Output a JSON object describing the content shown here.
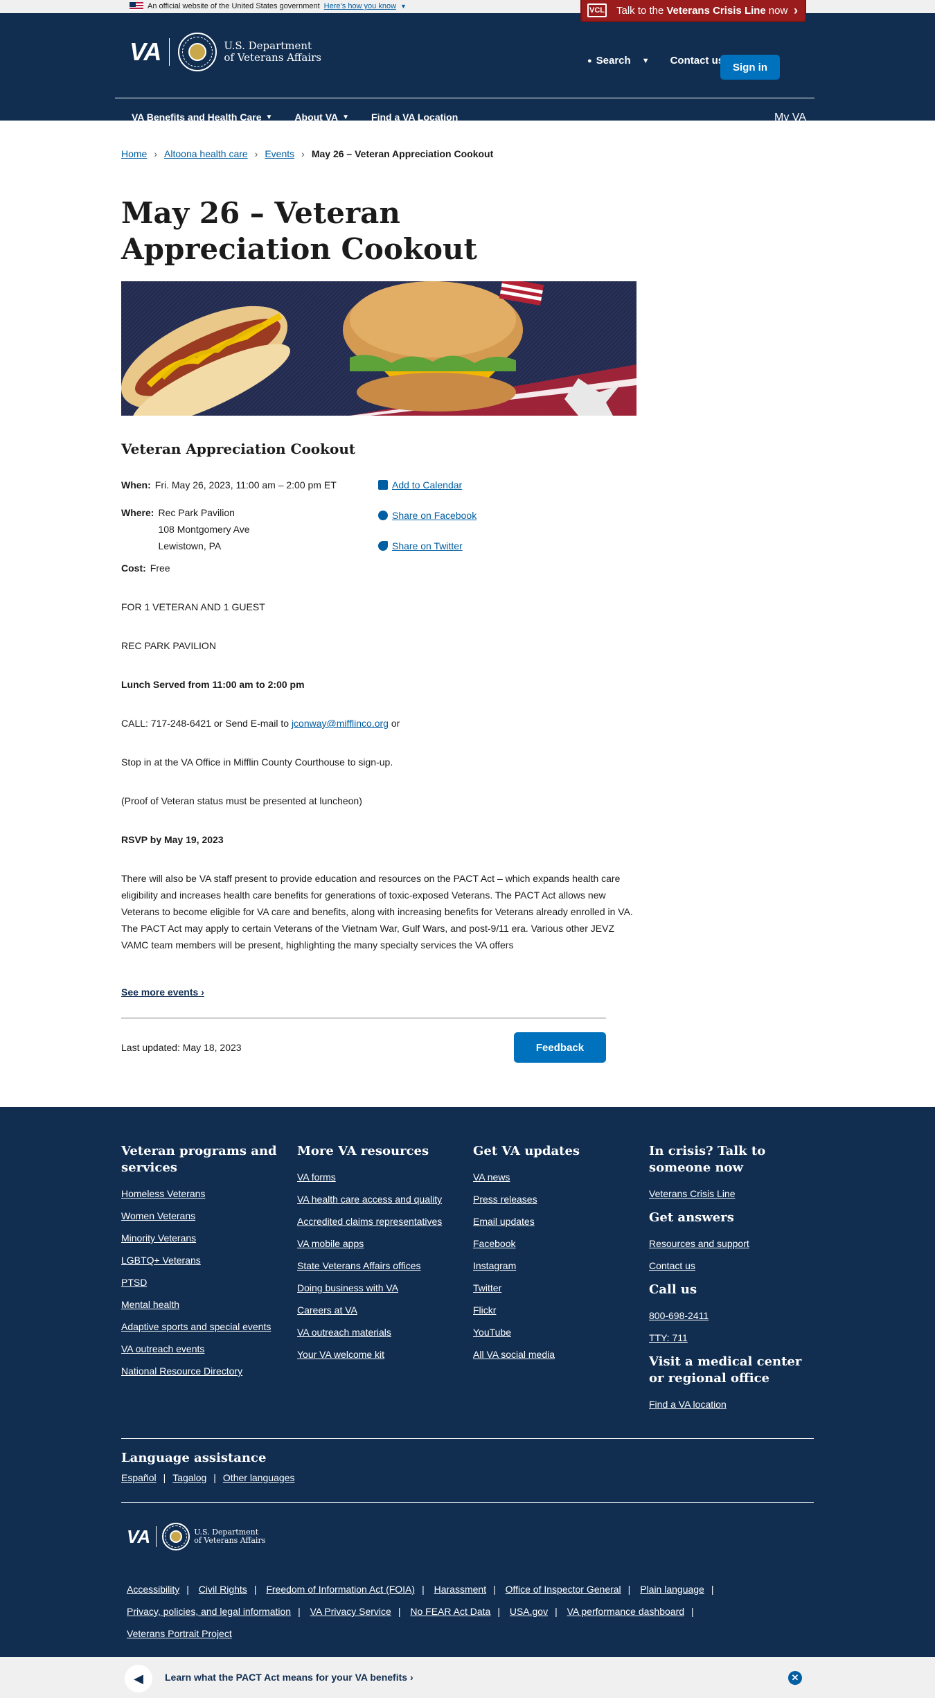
{
  "official_banner": {
    "text": "An official website of the United States government",
    "link": "Here’s how you know"
  },
  "crisis": {
    "prefix": "Talk to the",
    "name": "Veterans Crisis Line",
    "suffix": "now",
    "icon_text": "VCL"
  },
  "header": {
    "logo_va": "VA",
    "dept_line1": "U.S. Department",
    "dept_line2": "of Veterans Affairs",
    "search_label": "Search",
    "contact_label": "Contact us",
    "signin_label": "Sign in"
  },
  "nav": {
    "items": [
      "VA Benefits and Health Care",
      "About VA",
      "Find a VA Location"
    ],
    "myva": "My VA"
  },
  "breadcrumb": [
    "Home",
    "Altoona health care",
    "Events",
    "May 26 – Veteran Appreciation Cookout"
  ],
  "page": {
    "title": "May 26 – Veteran Appreciation Cookout",
    "event_heading": "Veteran Appreciation Cookout",
    "when_label": "When:",
    "when_value": "Fri. May 26, 2023, 11:00 am – 2:00 pm ET",
    "where_label": "Where:",
    "where_line1": "Rec Park Pavilion",
    "where_line2": "108 Montgomery Ave",
    "where_line3": "Lewistown, PA",
    "cost_label": "Cost:",
    "cost_value": "Free",
    "actions": [
      "Add to Calendar",
      "Share on Facebook",
      "Share on Twitter"
    ],
    "para1": "FOR 1 VETERAN AND 1 GUEST",
    "para2": "REC PARK PAVILION",
    "para3": "Lunch Served from 11:00 am to 2:00 pm",
    "para4_prefix": " CALL: 717-248-6421 or Send E-mail to ",
    "para4_email": "jconway@mifflinco.org",
    "para4_suffix": " or",
    "para5": "Stop in at the VA Office in Mifflin County Courthouse to sign-up.",
    "para6": "(Proof of Veteran status must be presented at luncheon)",
    "para7": "RSVP by May 19, 2023",
    "para8": "There will also be VA staff present to provide education and resources on the PACT Act – which expands health care eligibility and increases health care benefits for generations of toxic-exposed Veterans. The PACT Act allows new Veterans to become eligible for VA care and benefits, along with increasing benefits for Veterans already enrolled in VA. The PACT Act may apply to certain Veterans of the Vietnam War, Gulf Wars, and post-9/11 era. Various other JEVZ VAMC team members will be present, highlighting the many specialty services the VA offers",
    "see_more": "See more events",
    "last_updated": "Last updated: May 18, 2023",
    "feedback": "Feedback"
  },
  "footer": {
    "col1": {
      "title": "Veteran programs and services",
      "links": [
        "Homeless Veterans",
        "Women Veterans",
        "Minority Veterans",
        "LGBTQ+ Veterans",
        "PTSD",
        "Mental health",
        "Adaptive sports and special events",
        "VA outreach events",
        "National Resource Directory"
      ]
    },
    "col2": {
      "title": "More VA resources",
      "links": [
        "VA forms",
        "VA health care access and quality",
        "Accredited claims representatives",
        "VA mobile apps",
        "State Veterans Affairs offices",
        "Doing business with VA",
        "Careers at VA",
        "VA outreach materials",
        "Your VA welcome kit"
      ]
    },
    "col3": {
      "title": "Get VA updates",
      "links": [
        "VA news",
        "Press releases",
        "Email updates",
        "Facebook",
        "Instagram",
        "Twitter",
        "Flickr",
        "YouTube",
        "All VA social media"
      ]
    },
    "col4": {
      "title": "In crisis? Talk to someone now",
      "crisis_link": "Veterans Crisis Line",
      "answers_title": "Get answers",
      "answers_links": [
        "Resources and support",
        "Contact us"
      ],
      "call_title": "Call us",
      "call_links": [
        "800-698-2411",
        "TTY: 711"
      ],
      "visit_title": "Visit a medical center or regional office",
      "visit_link": "Find a VA location"
    },
    "language": {
      "title": "Language assistance",
      "links": [
        "Español",
        "Tagalog",
        "Other languages"
      ]
    },
    "bottom_links": [
      "Accessibility",
      "Civil Rights",
      "Freedom of Information Act (FOIA)",
      "Harassment",
      "Office of Inspector General",
      "Plain language",
      "Privacy, policies, and legal information",
      "VA Privacy Service",
      "No FEAR Act Data",
      "USA.gov",
      "VA performance dashboard",
      "Veterans Portrait Project"
    ]
  },
  "pact_banner": {
    "text": "Learn what the PACT Act means for your VA benefits"
  },
  "colors": {
    "header_bg": "#112e51",
    "link": "#005ea2",
    "button": "#0071bc",
    "crisis": "#9b1c1c"
  }
}
